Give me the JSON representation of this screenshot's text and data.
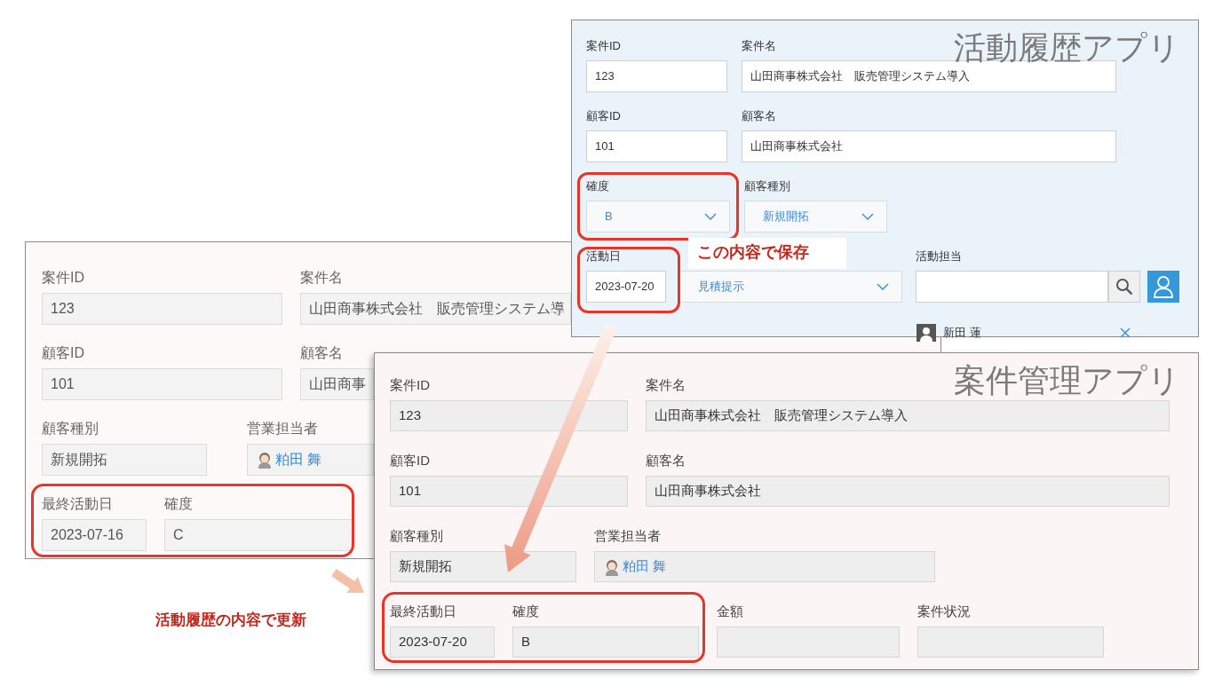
{
  "background_app": {
    "rows": [
      [
        {
          "label": "案件ID",
          "value": "123",
          "kind": "text"
        },
        {
          "label": "案件名",
          "value": "山田商事株式会社　販売管理システム導",
          "kind": "text"
        }
      ],
      [
        {
          "label": "顧客ID",
          "value": "101",
          "kind": "text"
        },
        {
          "label": "顧客名",
          "value": "山田商事",
          "kind": "text"
        }
      ],
      [
        {
          "label": "顧客種別",
          "value": "新規開拓",
          "kind": "text"
        },
        {
          "label": "営業担当者",
          "value": "粕田 舞",
          "kind": "user"
        }
      ],
      [
        {
          "label": "最終活動日",
          "value": "2023-07-16",
          "kind": "text"
        },
        {
          "label": "確度",
          "value": "C",
          "kind": "text"
        }
      ]
    ]
  },
  "activity_app": {
    "title": "活動履歴アプリ",
    "rows": [
      [
        {
          "label": "案件ID",
          "value": "123",
          "kind": "text"
        },
        {
          "label": "案件名",
          "value": "山田商事株式会社　販売管理システム導入",
          "kind": "text"
        }
      ],
      [
        {
          "label": "顧客ID",
          "value": "101",
          "kind": "text"
        },
        {
          "label": "顧客名",
          "value": "山田商事株式会社",
          "kind": "text"
        }
      ],
      [
        {
          "label": "確度",
          "value": "B",
          "kind": "select"
        },
        {
          "label": "顧客種別",
          "value": "新規開拓",
          "kind": "select"
        }
      ],
      [
        {
          "label": "活動日",
          "value": "2023-07-20",
          "kind": "text"
        },
        {
          "value": "見積提示",
          "kind": "select"
        },
        {
          "label": "活動担当",
          "kind": "search"
        }
      ]
    ],
    "assignee": {
      "name": "新田 蓮"
    }
  },
  "case_app": {
    "title": "案件管理アプリ",
    "rows": [
      [
        {
          "label": "案件ID",
          "value": "123",
          "kind": "text"
        },
        {
          "label": "案件名",
          "value": "山田商事株式会社　販売管理システム導入",
          "kind": "text"
        }
      ],
      [
        {
          "label": "顧客ID",
          "value": "101",
          "kind": "text"
        },
        {
          "label": "顧客名",
          "value": "山田商事株式会社",
          "kind": "text"
        }
      ],
      [
        {
          "label": "顧客種別",
          "value": "新規開拓",
          "kind": "text"
        },
        {
          "label": "営業担当者",
          "value": "粕田 舞",
          "kind": "user"
        }
      ],
      [
        {
          "label": "最終活動日",
          "value": "2023-07-20",
          "kind": "text"
        },
        {
          "label": "確度",
          "value": "B",
          "kind": "text"
        },
        {
          "label": "金額",
          "kind": "text"
        },
        {
          "label": "案件状況",
          "kind": "text"
        }
      ]
    ]
  },
  "annotations": {
    "save_note": "この内容で保存",
    "update_note": "活動履歴の内容で更新"
  }
}
